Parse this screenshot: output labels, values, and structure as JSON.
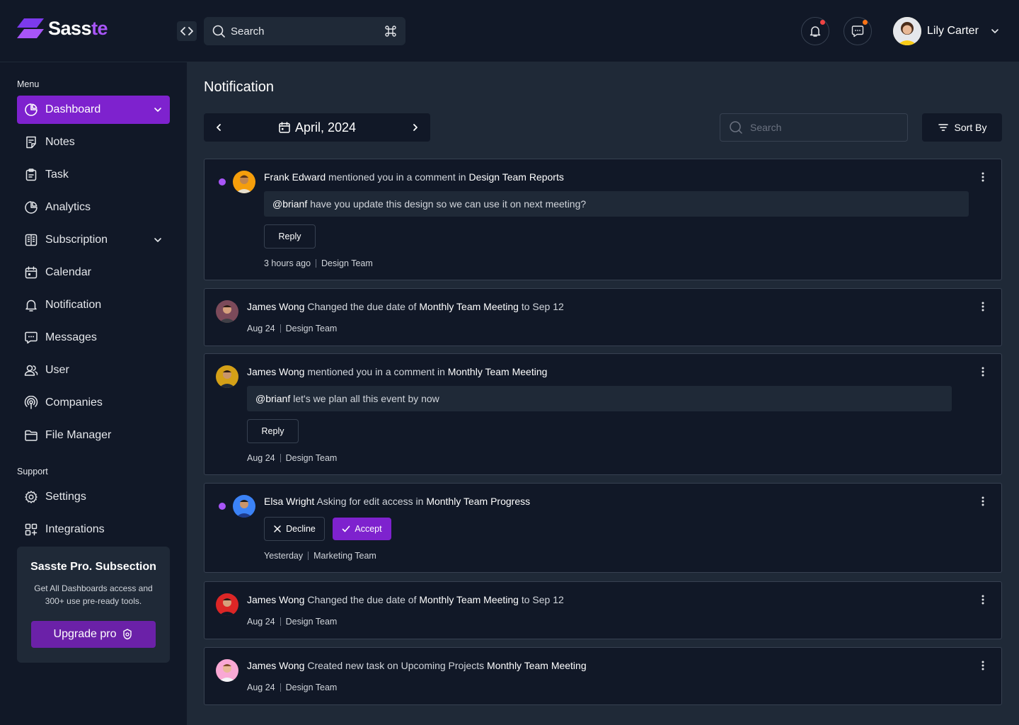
{
  "brand": {
    "name_part1": "Sass",
    "name_part2": "te",
    "color": "#7c3aed"
  },
  "header": {
    "search_placeholder": "Search",
    "shortcut_icon": "command-icon",
    "user_name": "Lily Carter"
  },
  "sidebar": {
    "menu_label": "Menu",
    "support_label": "Support",
    "items": [
      {
        "label": "Dashboard",
        "icon": "pie-chart-icon"
      },
      {
        "label": "Notes",
        "icon": "note-icon"
      },
      {
        "label": "Task",
        "icon": "clipboard-icon"
      },
      {
        "label": "Analytics",
        "icon": "chart-icon"
      },
      {
        "label": "Subscription",
        "icon": "columns-icon"
      },
      {
        "label": "Calendar",
        "icon": "calendar-icon"
      },
      {
        "label": "Notification",
        "icon": "bell-icon"
      },
      {
        "label": "Messages",
        "icon": "message-icon"
      },
      {
        "label": "User",
        "icon": "users-icon"
      },
      {
        "label": "Companies",
        "icon": "broadcast-icon"
      },
      {
        "label": "File Manager",
        "icon": "folder-icon"
      }
    ],
    "support_items": [
      {
        "label": "Settings",
        "icon": "gear-icon"
      },
      {
        "label": "Integrations",
        "icon": "apps-icon"
      }
    ],
    "promo": {
      "title": "Sasste Pro. Subsection",
      "description": "Get All Dashboards access and 300+ use pre-ready tools.",
      "button_label": "Upgrade pro"
    }
  },
  "main": {
    "title": "Notification",
    "month": "April, 2024",
    "search_placeholder": "Search",
    "sort_label": "Sort By",
    "colors": {
      "accent": "#7e22ce",
      "unread": "#a855f7"
    },
    "notifications": [
      {
        "user": "Frank Edward",
        "action": "mentioned you in a comment in",
        "target": "Design Team Reports",
        "suffix": "",
        "quote_mention": "@brianf",
        "quote_text": "have you update this design so we can use it on next meeting?",
        "reply_label": "Reply",
        "time": "3 hours ago",
        "team": "Design Team",
        "unread": true
      },
      {
        "user": "James Wong",
        "action": "Changed the due date of",
        "target": "Monthly Team Meeting",
        "suffix": "to Sep 12",
        "time": "Aug 24",
        "team": "Design Team",
        "unread": false
      },
      {
        "user": "James Wong",
        "action": "mentioned you in a comment in",
        "target": "Monthly Team Meeting",
        "suffix": "",
        "quote_mention": "@brianf",
        "quote_text": "let's we plan all this event by now",
        "reply_label": "Reply",
        "time": "Aug 24",
        "team": "Design Team",
        "unread": false
      },
      {
        "user": "Elsa Wright",
        "action": "Asking for edit access in",
        "target": "Monthly Team Progress",
        "suffix": "",
        "decline_label": "Decline",
        "accept_label": "Accept",
        "time": "Yesterday",
        "team": "Marketing Team",
        "unread": true
      },
      {
        "user": "James Wong",
        "action": "Changed the due date of",
        "target": "Monthly Team Meeting",
        "suffix": "to Sep 12",
        "time": "Aug 24",
        "team": "Design Team",
        "unread": false
      },
      {
        "user": "James Wong",
        "action": "Created new task on Upcoming Projects",
        "target": "Monthly Team Meeting",
        "suffix": "",
        "time": "Aug 24",
        "team": "Design Team",
        "unread": false
      }
    ]
  }
}
